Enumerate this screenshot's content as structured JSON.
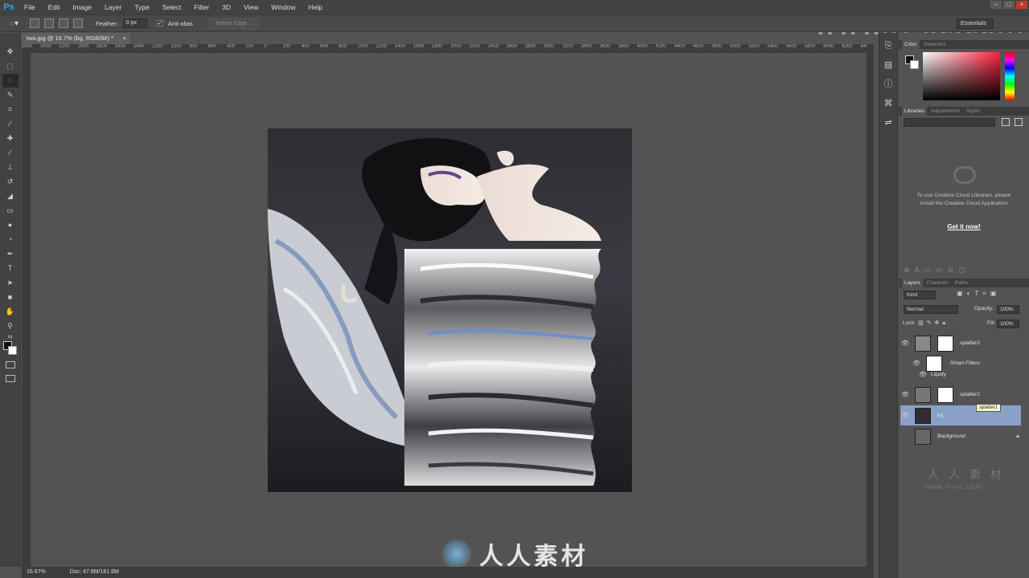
{
  "app": {
    "logo": "Ps"
  },
  "menu": [
    "File",
    "Edit",
    "Image",
    "Layer",
    "Type",
    "Select",
    "Filter",
    "3D",
    "View",
    "Window",
    "Help"
  ],
  "options_bar": {
    "feather_label": "Feather:",
    "feather_value": "0 px",
    "antialias_label": "Anti-alias",
    "refine_edge_label": "Refine Edge...",
    "workspace": "Essentials"
  },
  "document": {
    "tab_title": "two.jpg @ 16.7% (bg, RGB/8#) *",
    "close": "×",
    "ruler_ticks": [
      "2600",
      "2400",
      "2200",
      "2000",
      "1800",
      "1600",
      "1400",
      "1200",
      "1000",
      "800",
      "600",
      "400",
      "200",
      "0",
      "200",
      "400",
      "600",
      "800",
      "1000",
      "1200",
      "1400",
      "1600",
      "1800",
      "2000",
      "2200",
      "2400",
      "2600",
      "2800",
      "3000",
      "3200",
      "3400",
      "3600",
      "3800",
      "4000",
      "4200",
      "4400",
      "4600",
      "4800",
      "5000",
      "5200",
      "5400",
      "5600",
      "5800",
      "6000",
      "6200",
      "640"
    ]
  },
  "status": {
    "zoom": "16.67%",
    "doc": "Doc: 47.6M/181.6M"
  },
  "color_panel": {
    "tabs": [
      "Color",
      "Swatches"
    ]
  },
  "libraries_panel": {
    "tabs": [
      "Libraries",
      "Adjustments",
      "Styles"
    ],
    "message": "To use Creative Cloud Libraries, please install the Creative Cloud Application",
    "cta": "Get it now!"
  },
  "layers_panel": {
    "tabs": [
      "Layers",
      "Channels",
      "Paths"
    ],
    "kind_filter": "Kind",
    "blend_mode": "Normal",
    "opacity_label": "Opacity:",
    "opacity_value": "100%",
    "lock_label": "Lock:",
    "fill_label": "Fill:",
    "fill_value": "100%",
    "layers": [
      {
        "name": "splatter2"
      },
      {
        "name": "Smart Filters"
      },
      {
        "name": "Liquify"
      },
      {
        "name": "splatter1"
      },
      {
        "name": "bg"
      },
      {
        "name": "Background"
      }
    ],
    "tooltip": "splatter1"
  },
  "watermarks": {
    "url": "www.rr-sc.com",
    "cn": "人人素材",
    "cn_small": "人 人 素 材",
    "url_small": "www.rr-sc.com"
  }
}
